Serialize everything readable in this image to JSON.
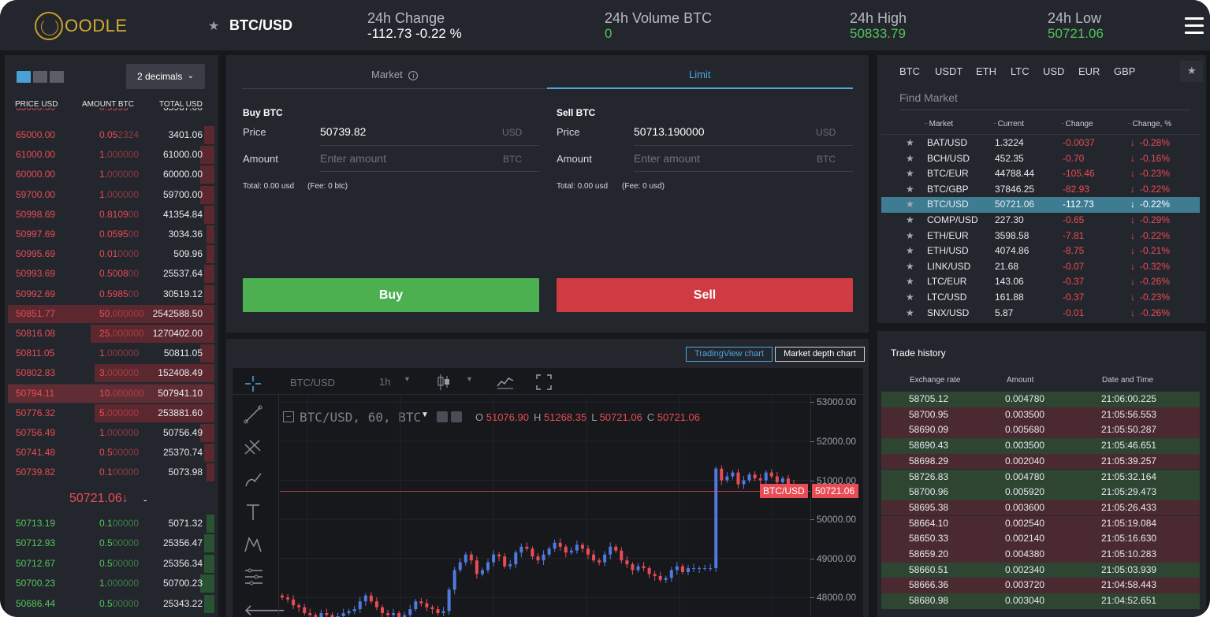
{
  "header": {
    "logo": "OODLE",
    "pair": "BTC/USD",
    "stats": [
      {
        "label": "24h Change",
        "value": "-112.73 -0.22 %"
      },
      {
        "label": "24h Volume BTC",
        "value": "0"
      },
      {
        "label": "24h High",
        "value": "50833.79"
      },
      {
        "label": "24h Low",
        "value": "50721.06"
      }
    ]
  },
  "orderbook": {
    "decimals": "2 decimals",
    "headers": [
      "PRICE USD",
      "AMOUNT BTC",
      "TOTAL USD"
    ],
    "asks": [
      {
        "price": "65000.00",
        "amount_main": "0.05",
        "amount_dim": "2324",
        "total": "3401.06",
        "depth": 0.05,
        "highlight": false
      },
      {
        "price": "61000.00",
        "amount_main": "1.",
        "amount_dim": "000000",
        "total": "61000.00",
        "depth": 0.07,
        "highlight": false
      },
      {
        "price": "60000.00",
        "amount_main": "1.",
        "amount_dim": "000000",
        "total": "60000.00",
        "depth": 0.07,
        "highlight": false
      },
      {
        "price": "59700.00",
        "amount_main": "1.",
        "amount_dim": "000000",
        "total": "59700.00",
        "depth": 0.07,
        "highlight": false
      },
      {
        "price": "50998.69",
        "amount_main": "0.8109",
        "amount_dim": "00",
        "total": "41354.84",
        "depth": 0.05,
        "highlight": false
      },
      {
        "price": "50997.69",
        "amount_main": "0.0595",
        "amount_dim": "00",
        "total": "3034.36",
        "depth": 0.04,
        "highlight": false
      },
      {
        "price": "50995.69",
        "amount_main": "0.01",
        "amount_dim": "0000",
        "total": "509.96",
        "depth": 0.04,
        "highlight": false
      },
      {
        "price": "50993.69",
        "amount_main": "0.5008",
        "amount_dim": "00",
        "total": "25537.64",
        "depth": 0.05,
        "highlight": false
      },
      {
        "price": "50992.69",
        "amount_main": "0.5985",
        "amount_dim": "00",
        "total": "30519.12",
        "depth": 0.05,
        "highlight": false
      },
      {
        "price": "50851.77",
        "amount_main": "50.",
        "amount_dim": "000000",
        "total": "2542588.50",
        "depth": 1.0,
        "highlight": false
      },
      {
        "price": "50816.08",
        "amount_main": "25.",
        "amount_dim": "000000",
        "total": "1270402.00",
        "depth": 0.6,
        "highlight": false
      },
      {
        "price": "50811.05",
        "amount_main": "1.",
        "amount_dim": "000000",
        "total": "50811.05",
        "depth": 0.07,
        "highlight": false
      },
      {
        "price": "50802.83",
        "amount_main": "3.",
        "amount_dim": "000000",
        "total": "152408.49",
        "depth": 0.58,
        "highlight": false
      },
      {
        "price": "50794.11",
        "amount_main": "10.",
        "amount_dim": "000000",
        "total": "507941.10",
        "depth": 1.0,
        "highlight": true
      },
      {
        "price": "50776.32",
        "amount_main": "5.",
        "amount_dim": "000000",
        "total": "253881.60",
        "depth": 0.58,
        "highlight": false
      },
      {
        "price": "50756.49",
        "amount_main": "1.",
        "amount_dim": "000000",
        "total": "50756.49",
        "depth": 0.07,
        "highlight": false
      },
      {
        "price": "50741.48",
        "amount_main": "0.5",
        "amount_dim": "00000",
        "total": "25370.74",
        "depth": 0.05,
        "highlight": false
      },
      {
        "price": "50739.82",
        "amount_main": "0.1",
        "amount_dim": "00000",
        "total": "5073.98",
        "depth": 0.04,
        "highlight": false
      }
    ],
    "mid_price": "50721.06",
    "mid_arrow": "↓",
    "mid_dash": "-",
    "bids": [
      {
        "price": "50713.19",
        "amount_main": "0.1",
        "amount_dim": "00000",
        "total": "5071.32",
        "depth": 0.04
      },
      {
        "price": "50712.93",
        "amount_main": "0.5",
        "amount_dim": "00000",
        "total": "25356.47",
        "depth": 0.05
      },
      {
        "price": "50712.67",
        "amount_main": "0.5",
        "amount_dim": "00000",
        "total": "25356.34",
        "depth": 0.05
      },
      {
        "price": "50700.23",
        "amount_main": "1.",
        "amount_dim": "000000",
        "total": "50700.23",
        "depth": 0.07
      },
      {
        "price": "50686.44",
        "amount_main": "0.5",
        "amount_dim": "00000",
        "total": "25343.22",
        "depth": 0.05
      }
    ]
  },
  "order_form": {
    "tabs": [
      "Market",
      "Limit"
    ],
    "active_tab": "Limit",
    "buy": {
      "title": "Buy BTC",
      "price_label": "Price",
      "price": "50739.82",
      "price_unit": "USD",
      "amount_label": "Amount",
      "amount_placeholder": "Enter amount",
      "amount_unit": "BTC",
      "total": "Total: 0.00 usd",
      "fee": "(Fee: 0 btc)",
      "button": "Buy"
    },
    "sell": {
      "title": "Sell BTC",
      "price_label": "Price",
      "price": "50713.190000",
      "price_unit": "USD",
      "amount_label": "Amount",
      "amount_placeholder": "Enter amount",
      "amount_unit": "BTC",
      "total": "Total: 0.00 usd",
      "fee": "(Fee: 0 usd)",
      "button": "Sell"
    }
  },
  "chart": {
    "view_buttons": [
      "TradingView chart",
      "Market depth chart"
    ],
    "symbol": "BTC/USD",
    "interval": "1h",
    "legend_title": "BTC/USD, 60, BTC",
    "ohlc": [
      {
        "k": "O",
        "v": "51076.90"
      },
      {
        "k": "H",
        "v": "51268.35"
      },
      {
        "k": "L",
        "v": "50721.06"
      },
      {
        "k": "C",
        "v": "50721.06"
      }
    ],
    "y_ticks": [
      "53000.00",
      "52000.00",
      "51000.00",
      "50000.00",
      "49000.00",
      "48000.00"
    ],
    "y_range": [
      47500,
      53150
    ],
    "price_tag_label": "BTC/USD",
    "price_tag_value": "50721.06",
    "last_price": 50721.06,
    "colors": {
      "up": "#4f7ae0",
      "down": "#e84c55",
      "bg": "#17181c"
    }
  },
  "chart_data": {
    "type": "candlestick",
    "series_close": [
      48000,
      47950,
      47800,
      47750,
      47600,
      47550,
      47500,
      47600,
      47550,
      47500,
      47520,
      47600,
      47650,
      47700,
      47900,
      48050,
      47900,
      47750,
      47600,
      47550,
      47600,
      47500,
      47550,
      47700,
      47900,
      47850,
      47750,
      47700,
      47600,
      47650,
      48200,
      48700,
      48900,
      49100,
      48950,
      48600,
      48700,
      48900,
      49100,
      49050,
      48800,
      48850,
      49150,
      49300,
      49250,
      49050,
      48950,
      49100,
      49250,
      49400,
      49300,
      49150,
      49200,
      49350,
      49250,
      49100,
      48950,
      48900,
      49100,
      49300,
      49200,
      48950,
      48850,
      48700,
      48800,
      48750,
      48600,
      48550,
      48450,
      48500,
      48700,
      48800,
      48650,
      48750,
      48750,
      48750,
      48750,
      48750,
      51300,
      51000,
      51100,
      51200,
      50900,
      51000,
      51150,
      51050,
      51000,
      51200,
      51100,
      50950,
      51050,
      50900,
      50721
    ]
  },
  "markets": {
    "currencies": [
      "BTC",
      "USDT",
      "ETH",
      "LTC",
      "USD",
      "EUR",
      "GBP"
    ],
    "search_placeholder": "Find Market",
    "headers": [
      "Market",
      "Current",
      "Change",
      "Change, %"
    ],
    "rows": [
      {
        "market": "BAT/USD",
        "current": "1.3224",
        "change": "-0.0037",
        "pct": "-0.28%"
      },
      {
        "market": "BCH/USD",
        "current": "452.35",
        "change": "-0.70",
        "pct": "-0.16%"
      },
      {
        "market": "BTC/EUR",
        "current": "44788.44",
        "change": "-105.46",
        "pct": "-0.23%"
      },
      {
        "market": "BTC/GBP",
        "current": "37846.25",
        "change": "-82.93",
        "pct": "-0.22%"
      },
      {
        "market": "BTC/USD",
        "current": "50721.06",
        "change": "-112.73",
        "pct": "-0.22%",
        "selected": true
      },
      {
        "market": "COMP/USD",
        "current": "227.30",
        "change": "-0.65",
        "pct": "-0.29%"
      },
      {
        "market": "ETH/EUR",
        "current": "3598.58",
        "change": "-7.81",
        "pct": "-0.22%"
      },
      {
        "market": "ETH/USD",
        "current": "4074.86",
        "change": "-8.75",
        "pct": "-0.21%"
      },
      {
        "market": "LINK/USD",
        "current": "21.68",
        "change": "-0.07",
        "pct": "-0.32%"
      },
      {
        "market": "LTC/EUR",
        "current": "143.06",
        "change": "-0.37",
        "pct": "-0.26%"
      },
      {
        "market": "LTC/USD",
        "current": "161.88",
        "change": "-0.37",
        "pct": "-0.23%"
      },
      {
        "market": "SNX/USD",
        "current": "5.87",
        "change": "-0.01",
        "pct": "-0.26%"
      }
    ]
  },
  "trade_history": {
    "title": "Trade history",
    "headers": [
      "Exchange rate",
      "Amount",
      "Date and Time"
    ],
    "rows": [
      {
        "rate": "58705.12",
        "amount": "0.004780",
        "time": "21:06:00.225",
        "side": "buy"
      },
      {
        "rate": "58700.95",
        "amount": "0.003500",
        "time": "21:05:56.553",
        "side": "sell"
      },
      {
        "rate": "58690.09",
        "amount": "0.005680",
        "time": "21:05:50.287",
        "side": "sell"
      },
      {
        "rate": "58690.43",
        "amount": "0.003500",
        "time": "21:05:46.651",
        "side": "buy"
      },
      {
        "rate": "58698.29",
        "amount": "0.002040",
        "time": "21:05:39.257",
        "side": "sell"
      },
      {
        "rate": "58726.83",
        "amount": "0.004780",
        "time": "21:05:32.164",
        "side": "buy"
      },
      {
        "rate": "58700.96",
        "amount": "0.005920",
        "time": "21:05:29.473",
        "side": "buy"
      },
      {
        "rate": "58695.38",
        "amount": "0.003600",
        "time": "21:05:26.433",
        "side": "sell"
      },
      {
        "rate": "58664.10",
        "amount": "0.002540",
        "time": "21:05:19.084",
        "side": "sell"
      },
      {
        "rate": "58650.33",
        "amount": "0.002140",
        "time": "21:05:16.630",
        "side": "sell"
      },
      {
        "rate": "58659.20",
        "amount": "0.004380",
        "time": "21:05:10.283",
        "side": "sell"
      },
      {
        "rate": "58660.51",
        "amount": "0.002340",
        "time": "21:05:03.939",
        "side": "buy"
      },
      {
        "rate": "58666.36",
        "amount": "0.003720",
        "time": "21:04:58.443",
        "side": "sell"
      },
      {
        "rate": "58680.98",
        "amount": "0.003040",
        "time": "21:04:52.651",
        "side": "buy"
      }
    ]
  }
}
